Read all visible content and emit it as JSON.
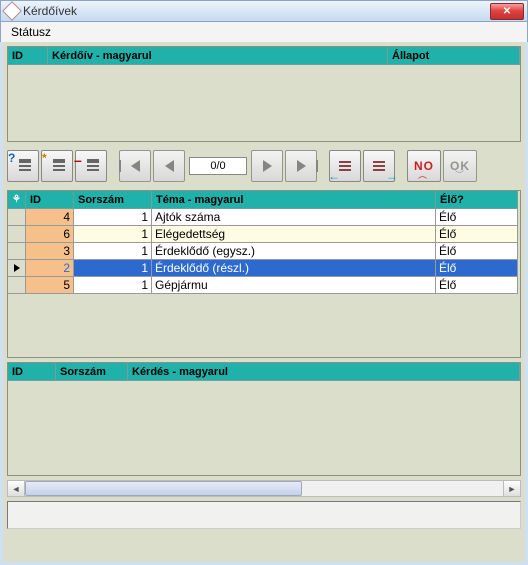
{
  "window": {
    "title": "Kérdőívek"
  },
  "menu": {
    "status": "Státusz"
  },
  "top_table": {
    "headers": {
      "id": "ID",
      "kerdoiv": "Kérdőív - magyarul",
      "allapot": "Állapot"
    }
  },
  "toolbar": {
    "counter": "0/0",
    "no_label": "NO",
    "ok_label": "OK"
  },
  "mid_table": {
    "headers": {
      "id": "ID",
      "sorszam": "Sorszám",
      "tema": "Téma - magyarul",
      "elo": "Élő?"
    },
    "rows": [
      {
        "id": "4",
        "sorszam": "1",
        "tema": "Ajtók száma",
        "elo": "Élő",
        "alt": false,
        "selected": false
      },
      {
        "id": "6",
        "sorszam": "1",
        "tema": "Elégedettség",
        "elo": "Élő",
        "alt": true,
        "selected": false
      },
      {
        "id": "3",
        "sorszam": "1",
        "tema": "Érdeklődő (egysz.)",
        "elo": "Élő",
        "alt": false,
        "selected": false
      },
      {
        "id": "2",
        "sorszam": "1",
        "tema": "Érdeklődő (részl.)",
        "elo": "Élő",
        "alt": true,
        "selected": true
      },
      {
        "id": "5",
        "sorszam": "1",
        "tema": "Gépjármu",
        "elo": "Élő",
        "alt": false,
        "selected": false
      }
    ]
  },
  "bottom_table": {
    "headers": {
      "id": "ID",
      "sorszam": "Sorszám",
      "kerdes": "Kérdés - magyarul"
    }
  }
}
